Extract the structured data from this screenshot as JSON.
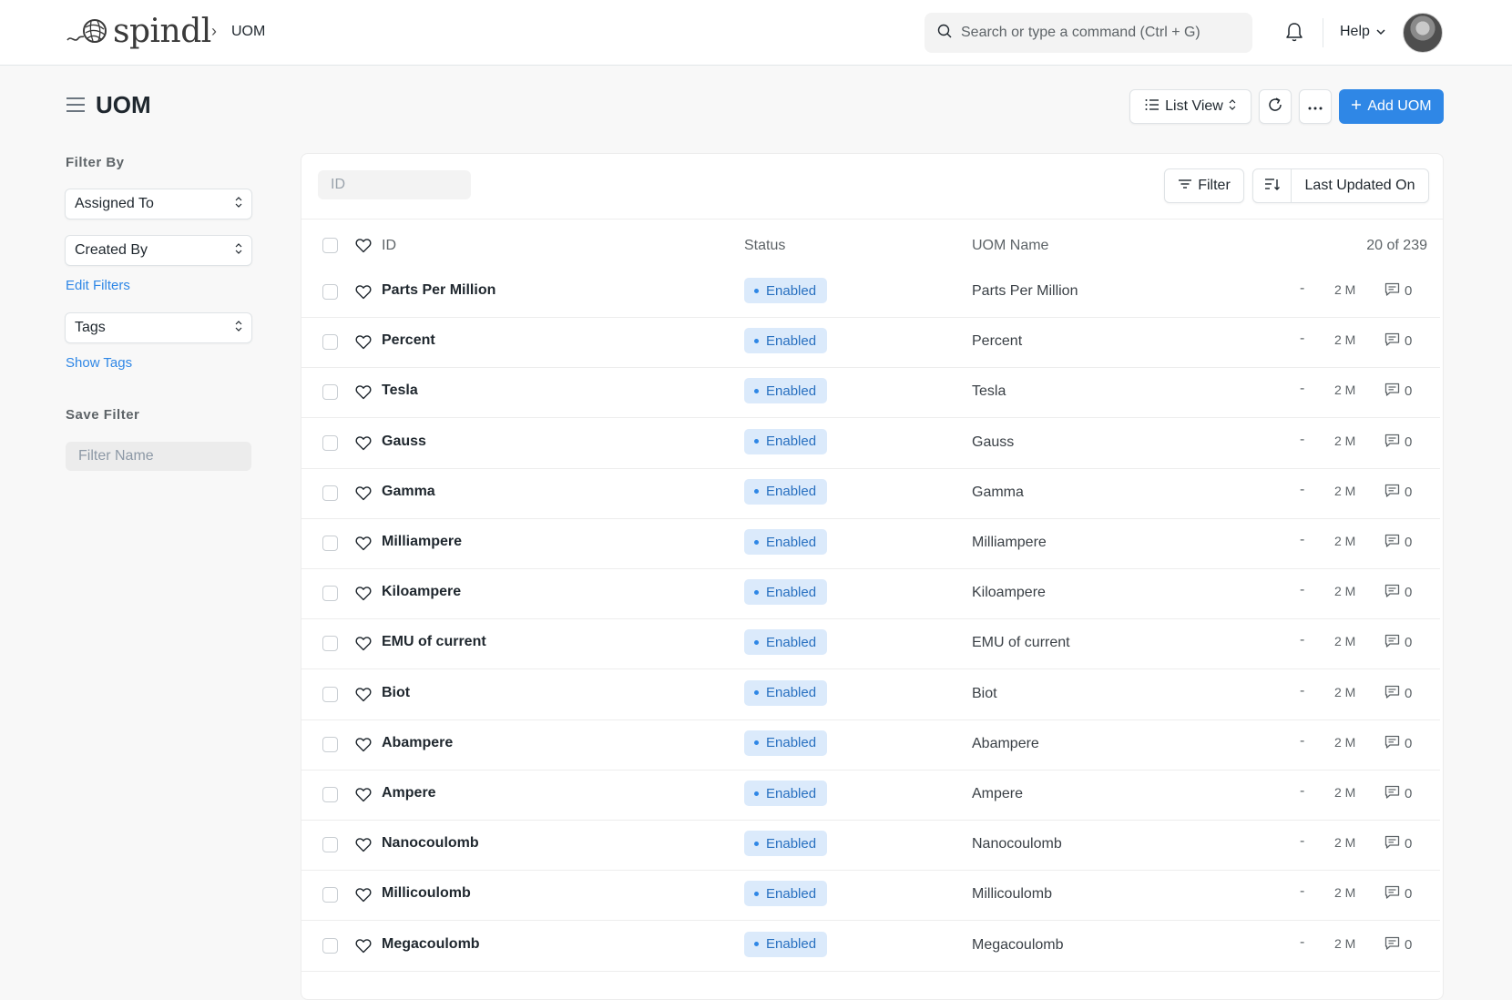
{
  "navbar": {
    "brand": "spindl",
    "breadcrumb": "UOM",
    "search_placeholder": "Search or type a command (Ctrl + G)",
    "help_label": "Help"
  },
  "page": {
    "title": "UOM",
    "list_view_label": "List View",
    "add_label": "Add UOM"
  },
  "sidebar": {
    "filter_by": "Filter By",
    "assigned_to": "Assigned To",
    "created_by": "Created By",
    "edit_filters": "Edit Filters",
    "tags": "Tags",
    "show_tags": "Show Tags",
    "save_filter": "Save Filter",
    "filter_name_placeholder": "Filter Name"
  },
  "list": {
    "id_placeholder": "ID",
    "filter_label": "Filter",
    "sort_label": "Last Updated On",
    "columns": {
      "id": "ID",
      "status": "Status",
      "name": "UOM Name"
    },
    "count": "20 of 239",
    "rows": [
      {
        "id": "Parts Per Million",
        "status": "Enabled",
        "name": "Parts Per Million",
        "dash": "-",
        "modified": "2 M",
        "comments": "0"
      },
      {
        "id": "Percent",
        "status": "Enabled",
        "name": "Percent",
        "dash": "-",
        "modified": "2 M",
        "comments": "0"
      },
      {
        "id": "Tesla",
        "status": "Enabled",
        "name": "Tesla",
        "dash": "-",
        "modified": "2 M",
        "comments": "0"
      },
      {
        "id": "Gauss",
        "status": "Enabled",
        "name": "Gauss",
        "dash": "-",
        "modified": "2 M",
        "comments": "0"
      },
      {
        "id": "Gamma",
        "status": "Enabled",
        "name": "Gamma",
        "dash": "-",
        "modified": "2 M",
        "comments": "0"
      },
      {
        "id": "Milliampere",
        "status": "Enabled",
        "name": "Milliampere",
        "dash": "-",
        "modified": "2 M",
        "comments": "0"
      },
      {
        "id": "Kiloampere",
        "status": "Enabled",
        "name": "Kiloampere",
        "dash": "-",
        "modified": "2 M",
        "comments": "0"
      },
      {
        "id": "EMU of current",
        "status": "Enabled",
        "name": "EMU of current",
        "dash": "-",
        "modified": "2 M",
        "comments": "0"
      },
      {
        "id": "Biot",
        "status": "Enabled",
        "name": "Biot",
        "dash": "-",
        "modified": "2 M",
        "comments": "0"
      },
      {
        "id": "Abampere",
        "status": "Enabled",
        "name": "Abampere",
        "dash": "-",
        "modified": "2 M",
        "comments": "0"
      },
      {
        "id": "Ampere",
        "status": "Enabled",
        "name": "Ampere",
        "dash": "-",
        "modified": "2 M",
        "comments": "0"
      },
      {
        "id": "Nanocoulomb",
        "status": "Enabled",
        "name": "Nanocoulomb",
        "dash": "-",
        "modified": "2 M",
        "comments": "0"
      },
      {
        "id": "Millicoulomb",
        "status": "Enabled",
        "name": "Millicoulomb",
        "dash": "-",
        "modified": "2 M",
        "comments": "0"
      },
      {
        "id": "Megacoulomb",
        "status": "Enabled",
        "name": "Megacoulomb",
        "dash": "-",
        "modified": "2 M",
        "comments": "0"
      }
    ]
  },
  "colors": {
    "primary": "#2f87e6",
    "badge_bg": "#dbeafb",
    "badge_text": "#2870c0",
    "page_bg": "#f8f8f8"
  },
  "icons": [
    "search-icon",
    "bell-icon",
    "chevron-down-icon",
    "menu-icon",
    "list-icon",
    "refresh-icon",
    "more-icon",
    "plus-icon",
    "filter-icon",
    "sort-icon",
    "heart-icon",
    "comment-icon",
    "yarn-logo-icon"
  ]
}
